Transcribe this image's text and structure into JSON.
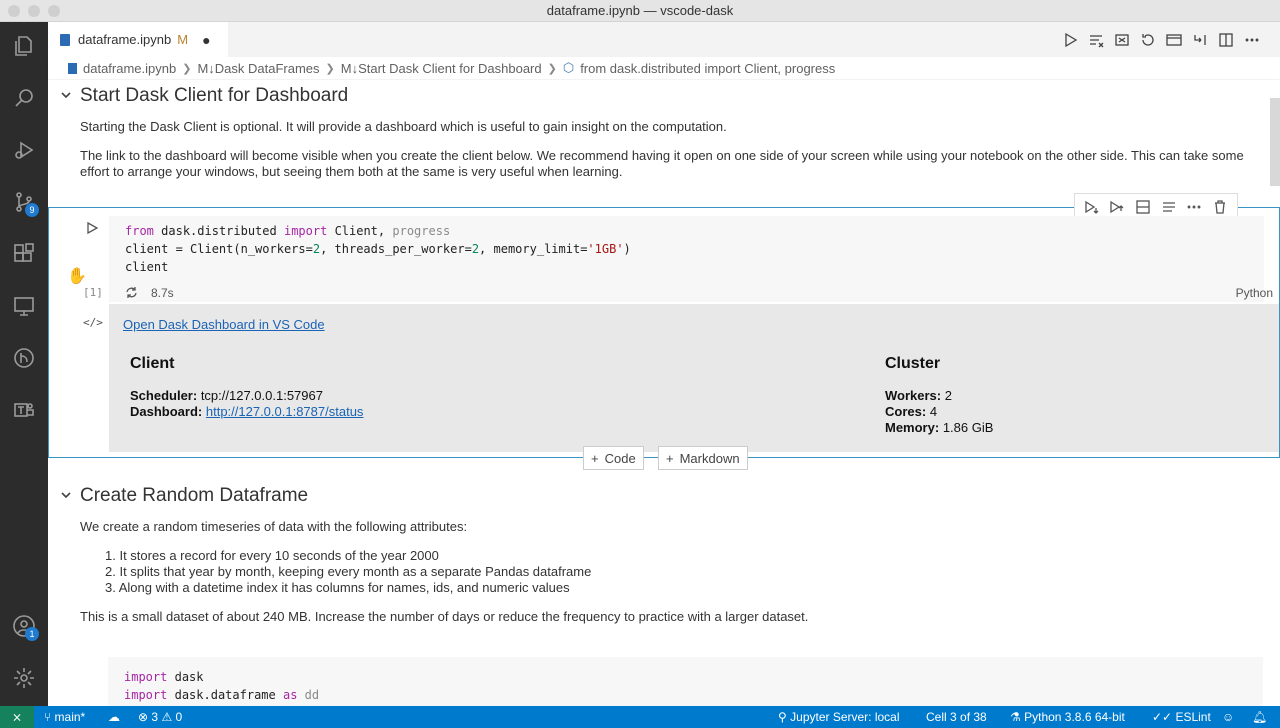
{
  "window": {
    "title": "dataframe.ipynb — vscode-dask"
  },
  "activity_bar": {
    "items": [
      {
        "name": "explorer-icon"
      },
      {
        "name": "search-icon"
      },
      {
        "name": "run-debug-icon"
      },
      {
        "name": "source-control-icon",
        "badge": "9"
      },
      {
        "name": "extensions-icon"
      },
      {
        "name": "remote-explorer-icon"
      },
      {
        "name": "git-graph-icon"
      },
      {
        "name": "teams-icon"
      }
    ],
    "accounts_badge": "1"
  },
  "tab": {
    "label": "dataframe.ipynb",
    "modified": "M",
    "dirty": "●"
  },
  "breadcrumbs": [
    "dataframe.ipynb",
    "M↓Dask DataFrames",
    "M↓Start Dask Client for Dashboard",
    "from dask.distributed import Client, progress"
  ],
  "section1": {
    "title": "Start Dask Client for Dashboard",
    "p1": "Starting the Dask Client is optional. It will provide a dashboard which is useful to gain insight on the computation.",
    "p2": "The link to the dashboard will become visible when you create the client below. We recommend having it open on one side of your screen while using your notebook on the other side. This can take some effort to arrange your windows, but seeing them both at the same is very useful when learning."
  },
  "code_cell": {
    "line1": {
      "kw1": "from",
      "mod": "dask.distributed",
      "kw2": "import",
      "name": "Client,",
      "dim": "progress"
    },
    "line2": {
      "a": "client = Client(",
      "p1": "n_workers=",
      "v1": "2",
      "c1": ", ",
      "p2": "threads_per_worker=",
      "v2": "2",
      "c2": ", ",
      "p3": "memory_limit=",
      "v3": "'1GB'",
      "end": ")"
    },
    "line3": "client",
    "exec_count": "[1]",
    "exec_time": "8.7s",
    "language": "Python"
  },
  "output": {
    "open_link": "Open Dask Dashboard in VS Code",
    "client": {
      "heading": "Client",
      "scheduler_label": "Scheduler:",
      "scheduler_value": "tcp://127.0.0.1:57967",
      "dashboard_label": "Dashboard:",
      "dashboard_value": "http://127.0.0.1:8787/status"
    },
    "cluster": {
      "heading": "Cluster",
      "workers_label": "Workers:",
      "workers_value": "2",
      "cores_label": "Cores:",
      "cores_value": "4",
      "memory_label": "Memory:",
      "memory_value": "1.86 GiB"
    }
  },
  "add_cell": {
    "code": "Code",
    "markdown": "Markdown"
  },
  "section2": {
    "title": "Create Random Dataframe",
    "intro": "We create a random timeseries of data with the following attributes:",
    "items": [
      "It stores a record for every 10 seconds of the year 2000",
      "It splits that year by month, keeping every month as a separate Pandas dataframe",
      "Along with a datetime index it has columns for names, ids, and numeric values"
    ],
    "outro": "This is a small dataset of about 240 MB. Increase the number of days or reduce the frequency to practice with a larger dataset."
  },
  "code_cell2": {
    "l1kw": "import",
    "l1": "dask",
    "l2kw": "import",
    "l2": "dask.dataframe",
    "l2as": "as",
    "l2alias": "dd"
  },
  "statusbar": {
    "branch": "main*",
    "errors": "3",
    "warnings": "0",
    "jupyter": "Jupyter Server: local",
    "cell": "Cell 3 of 38",
    "python": "Python 3.8.6 64-bit",
    "eslint": "ESLint"
  }
}
